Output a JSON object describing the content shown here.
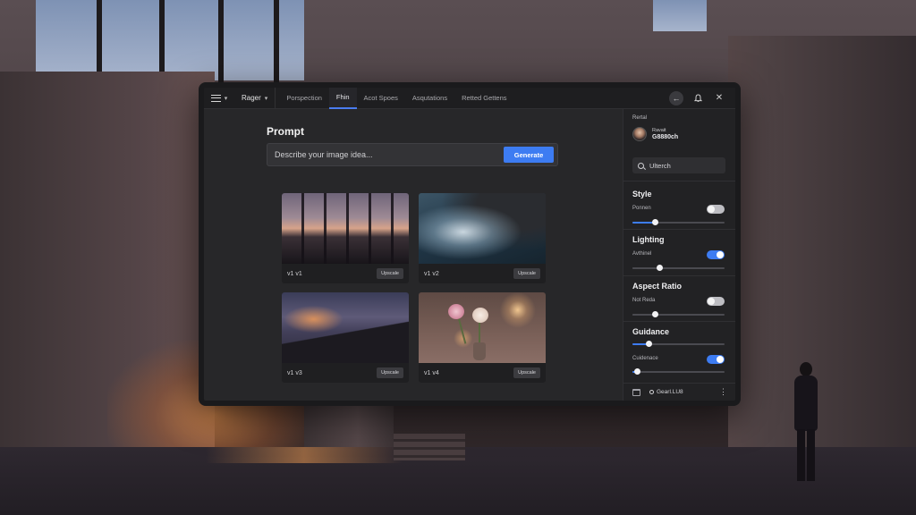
{
  "topbar": {
    "brand_label": "Rager",
    "tabs": [
      {
        "label": "Porspection",
        "active": false
      },
      {
        "label": "Fhin",
        "active": true
      },
      {
        "label": "Acot Spoes",
        "active": false
      },
      {
        "label": "Asqutations",
        "active": false
      },
      {
        "label": "Retted Gettens",
        "active": false
      }
    ],
    "controls": {
      "back_icon": "back-arrow-icon",
      "notify_icon": "bell-icon",
      "close_icon": "close-icon"
    }
  },
  "main": {
    "prompt_title": "Prompt",
    "prompt_placeholder": "Describe your image idea...",
    "generate_label": "Generate",
    "cards": [
      {
        "label": "v1   v1",
        "upscale": "Upscale",
        "scene": "dusk-window"
      },
      {
        "label": "v1   v2",
        "upscale": "Upscale",
        "scene": "ocean-waves"
      },
      {
        "label": "v1   v3",
        "upscale": "Upscale",
        "scene": "coastal-cliff-night"
      },
      {
        "label": "v1   v4",
        "upscale": "Upscale",
        "scene": "flowers-vase"
      }
    ]
  },
  "sidebar": {
    "header": "Rertal",
    "user": {
      "line1": "Ravait",
      "line2": "G8880ch"
    },
    "search_text": "Ulterch",
    "sections": [
      {
        "title": "Style",
        "option": "Ponnen",
        "toggle_on": false,
        "slider_value": 0.25
      },
      {
        "title": "Lighting",
        "option": "Avthinel",
        "toggle_on": true,
        "slider_value": 0.3
      },
      {
        "title": "Aspect Ratio",
        "option": "Not Reda",
        "toggle_on": false,
        "slider_value": 0.25
      },
      {
        "title": "Guidance",
        "option": "Cuidenace",
        "toggle_on": true,
        "slider_value": 0.18,
        "slider2_value": 0.05
      }
    ],
    "footer_text": "Gearl.LU8"
  },
  "colors": {
    "accent": "#3d7cf2",
    "window_bg": "#262628",
    "sidebar_bg": "#222224"
  }
}
